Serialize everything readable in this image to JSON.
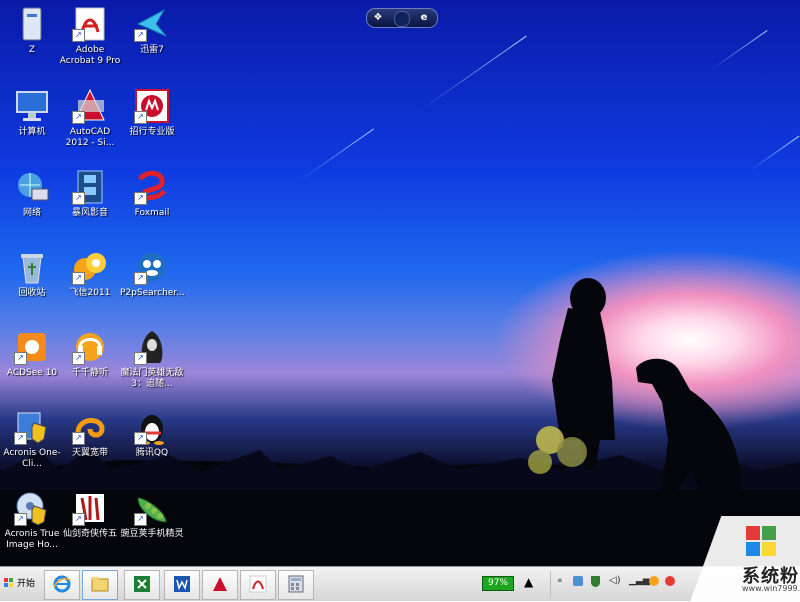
{
  "desktop_icons": [
    {
      "label": "Z",
      "icon": "computer-tower-icon"
    },
    {
      "label": "Adobe Acrobat 9 Pro",
      "icon": "acrobat-icon"
    },
    {
      "label": "迅雷7",
      "icon": "thunder-bird-icon"
    },
    {
      "label": "计算机",
      "icon": "monitor-icon"
    },
    {
      "label": "AutoCAD 2012 - Si...",
      "icon": "autocad-icon"
    },
    {
      "label": "招行专业版",
      "icon": "cmb-bank-icon"
    },
    {
      "label": "网络",
      "icon": "network-icon"
    },
    {
      "label": "暴风影音",
      "icon": "film-strip-icon"
    },
    {
      "label": "Foxmail",
      "icon": "foxmail-icon"
    },
    {
      "label": "回收站",
      "icon": "recycle-bin-icon"
    },
    {
      "label": "飞信2011",
      "icon": "fetion-icon"
    },
    {
      "label": "P2pSearcher...",
      "icon": "p2p-searcher-icon"
    },
    {
      "label": "ACDSee 10",
      "icon": "acdsee-icon"
    },
    {
      "label": "千千静听",
      "icon": "ttplayer-icon"
    },
    {
      "label": "魔法门英雄无敌3：追随...",
      "icon": "heroes-game-icon"
    },
    {
      "label": "Acronis One-Cli...",
      "icon": "acronis-shield-icon"
    },
    {
      "label": "天翼宽带",
      "icon": "tianyi-broadband-icon"
    },
    {
      "label": "腾讯QQ",
      "icon": "qq-penguin-icon"
    },
    {
      "label": "Acronis True Image Ho...",
      "icon": "acronis-disc-icon"
    },
    {
      "label": "仙剑奇侠传五",
      "icon": "xianjian-game-icon"
    },
    {
      "label": "豌豆荚手机精灵",
      "icon": "wandoujia-pea-icon"
    }
  ],
  "taskbar": {
    "start_label": "开始",
    "pinned": [
      "ie-icon",
      "explorer-folder-icon",
      "excel-icon",
      "word-icon",
      "autocad-icon",
      "acrobat-icon",
      "calculator-icon"
    ],
    "battery_percent": "97%",
    "tray_icons": [
      "chevron-up-icon",
      "network-tray-icon",
      "shield-tray-icon",
      "volume-icon",
      "signal-icon",
      "qq-tray-icon",
      "user-tray-icon"
    ]
  },
  "watermark": {
    "text": "系统粉",
    "url": "www.win7999.com"
  },
  "colors": {
    "sky_top": "#0a1aa8",
    "sky_mid": "#1f68ee",
    "sunset": "#f090c0",
    "ground": "#05070f",
    "taskbar": "#e6e6e6",
    "battery": "#1fa51f"
  }
}
